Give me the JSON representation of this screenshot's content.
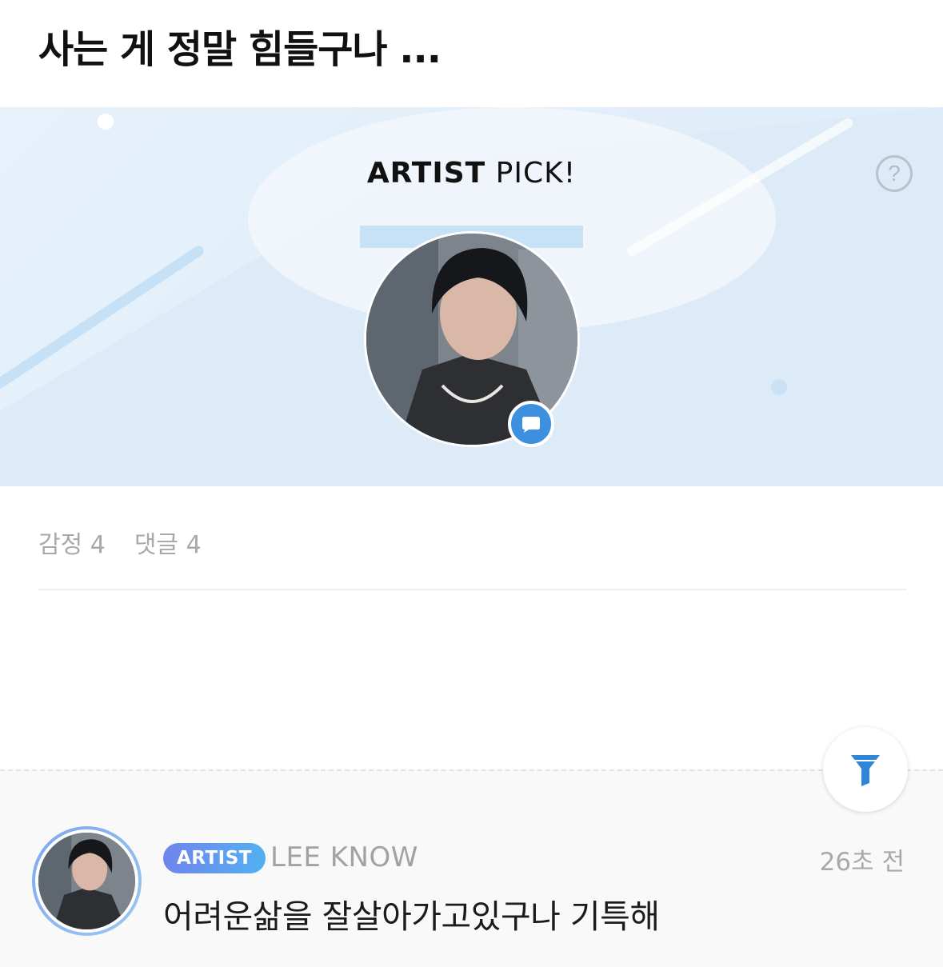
{
  "post": {
    "title": "사는 게 정말 힘들구나 ..."
  },
  "banner": {
    "pick_bold": "ARTIST",
    "pick_rest": " PICK!",
    "help_label": "?",
    "colors": {
      "background": "#e3f0fb",
      "badge": "#3d8fe0"
    }
  },
  "stats": {
    "reactions": "감정 4",
    "comments": "댓글 4"
  },
  "comment": {
    "badge": "ARTIST",
    "author": "LEE KNOW",
    "time": "26초 전",
    "text": "어려운삶을 잘살아가고있구나 기특해"
  },
  "icons": {
    "help": "question-circle-icon",
    "chat": "chat-bubble-icon",
    "filter": "filter-funnel-icon"
  }
}
